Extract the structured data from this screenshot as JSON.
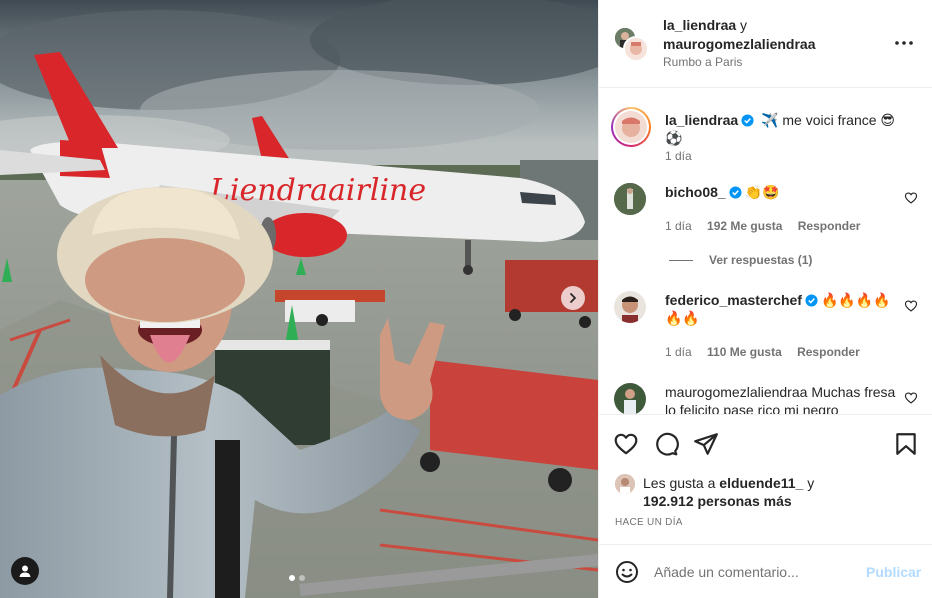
{
  "post": {
    "plane_text": "Liendraairline",
    "dots_count": 2,
    "icons": {
      "next": "chevron-right-icon",
      "tag": "user-tag-icon"
    }
  },
  "header": {
    "user1": "la_liendraa",
    "connector": "y",
    "user2": "maurogomezlaliendraa",
    "location": "Rumbo a Paris",
    "more_icon": "more-horizontal-icon"
  },
  "caption": {
    "user": "la_liendraa",
    "text": "me voici france",
    "emoji_before": "✈️",
    "emoji_after": "😎 ⚽",
    "time": "1 día"
  },
  "comments": [
    {
      "user": "bicho08_",
      "verified": true,
      "text": "👏🤩",
      "time": "1 día",
      "likes": "192 Me gusta",
      "reply": "Responder",
      "view_replies": "Ver respuestas (1)"
    },
    {
      "user": "federico_masterchef",
      "verified": true,
      "text": "🔥🔥🔥🔥🔥🔥",
      "time": "1 día",
      "likes": "110 Me gusta",
      "reply": "Responder"
    },
    {
      "user": "maurogomezlaliendraa",
      "verified": false,
      "text": "Muchas fresa lo felicito pase rico mi negro"
    }
  ],
  "actions": {
    "like": "heart-icon",
    "comment": "comment-icon",
    "share": "send-icon",
    "save": "bookmark-icon"
  },
  "likes": {
    "prefix": "Les gusta a",
    "user": "elduende11_",
    "connector": "y",
    "count_text": "192.912 personas más"
  },
  "timestamp": "HACE UN DÍA",
  "add_comment": {
    "placeholder": "Añade un comentario...",
    "button": "Publicar",
    "emoji_icon": "smiley-icon"
  },
  "colors": {
    "accent": "#0095f6",
    "publish_disabled": "#b3dbff",
    "verified": "#0095f6",
    "plane_red": "#d8262a"
  }
}
